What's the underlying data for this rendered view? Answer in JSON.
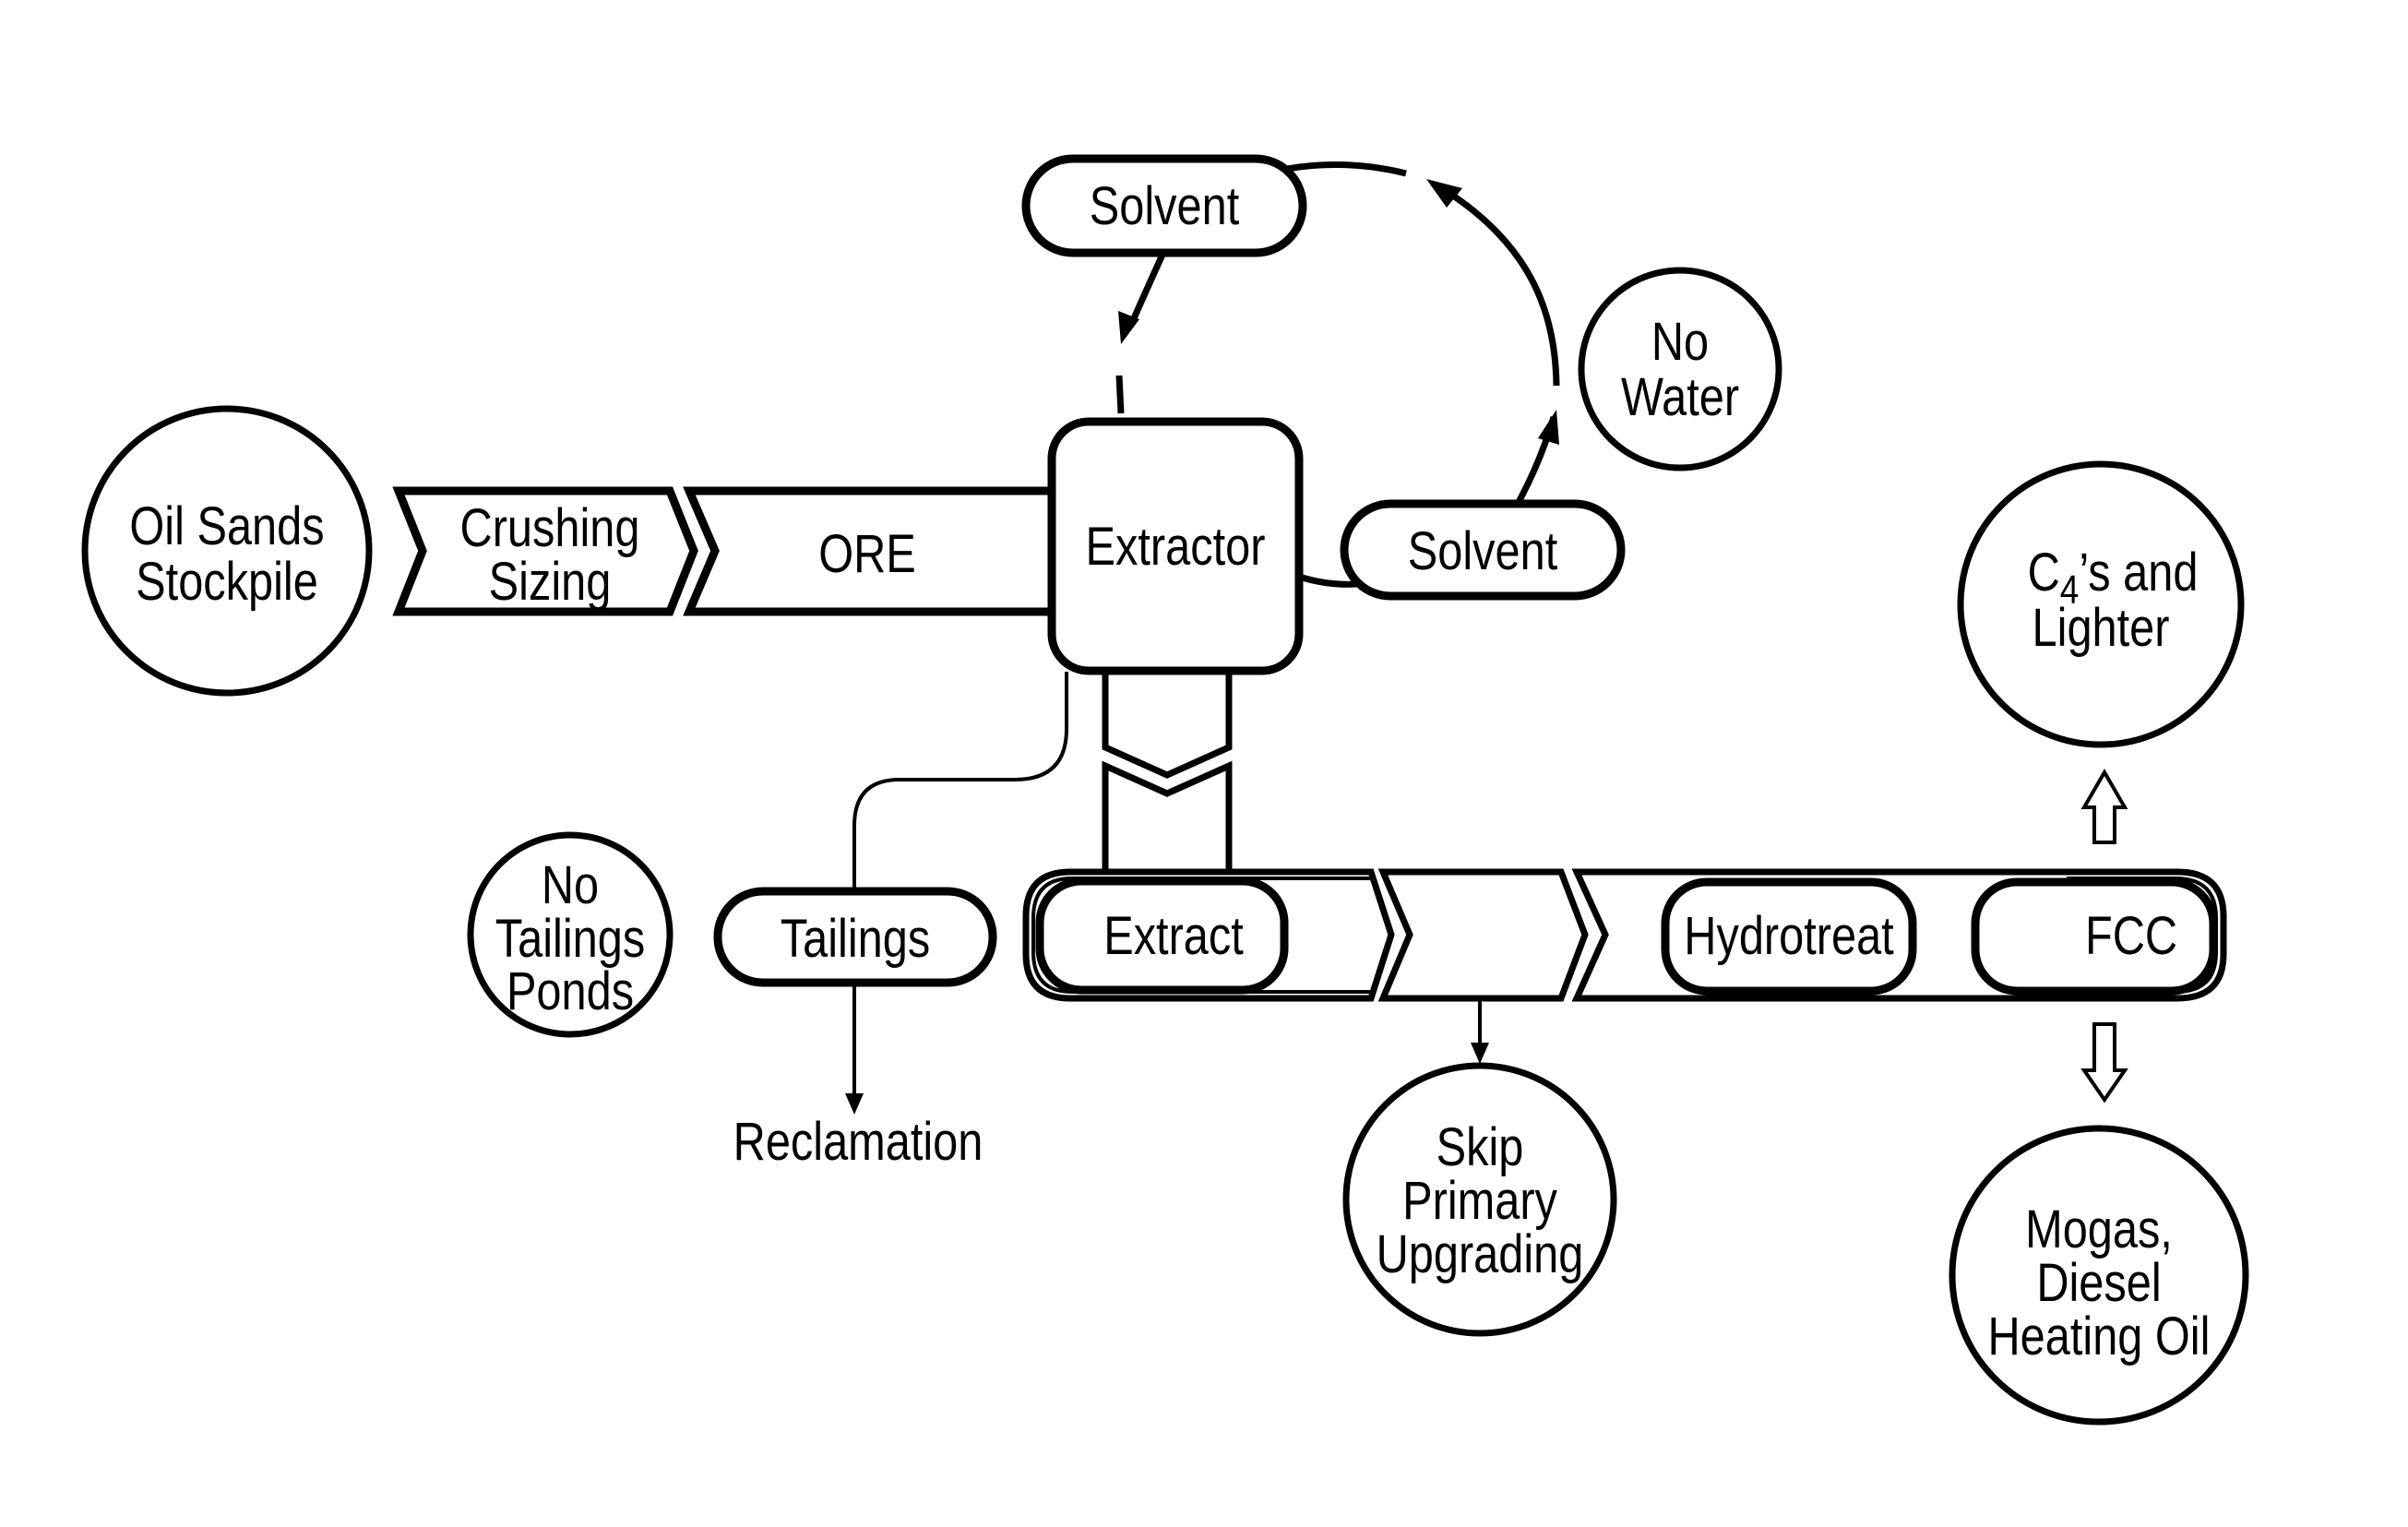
{
  "diagram": {
    "type": "process-flow",
    "colors": {
      "stroke": "#000000",
      "background": "#ffffff"
    },
    "nodes": {
      "oil_sands": {
        "shape": "circle",
        "lines": [
          "Oil Sands",
          "Stockpile"
        ]
      },
      "crushing": {
        "shape": "chevron",
        "lines": [
          "Crushing",
          "Sizing"
        ]
      },
      "ore": {
        "shape": "chevron",
        "label": "ORE"
      },
      "extractor": {
        "shape": "rounded-box",
        "label": "Extractor"
      },
      "solvent_top": {
        "shape": "pill",
        "label": "Solvent"
      },
      "solvent_right": {
        "shape": "pill",
        "label": "Solvent"
      },
      "no_water": {
        "shape": "circle",
        "lines": [
          "No",
          "Water"
        ]
      },
      "no_tailings": {
        "shape": "circle",
        "lines": [
          "No",
          "Tailings",
          "Ponds"
        ]
      },
      "tailings": {
        "shape": "pill",
        "label": "Tailings"
      },
      "reclamation": {
        "shape": "text",
        "label": "Reclamation"
      },
      "extract": {
        "shape": "pill",
        "label": "Extract"
      },
      "skip_segment": {
        "shape": "chevron",
        "label": ""
      },
      "hydrotreat": {
        "shape": "pill",
        "label": "Hydrotreat"
      },
      "fcc": {
        "shape": "pill",
        "label": "FCC"
      },
      "skip_primary": {
        "shape": "circle",
        "lines": [
          "Skip",
          "Primary",
          "Upgrading"
        ]
      },
      "c4_lighter": {
        "shape": "circle",
        "lines_main": [
          "C",
          "’s and",
          "Lighter"
        ],
        "subscript": "4"
      },
      "mogas": {
        "shape": "circle",
        "lines": [
          "Mogas,",
          "Diesel",
          "Heating Oil"
        ]
      }
    },
    "edges": [
      {
        "from": "oil_sands",
        "to": "crushing",
        "style": "adjacent"
      },
      {
        "from": "crushing",
        "to": "ore",
        "style": "chevron"
      },
      {
        "from": "ore",
        "to": "extractor",
        "style": "chevron"
      },
      {
        "from": "extractor",
        "to": "solvent_right",
        "style": "line"
      },
      {
        "from": "solvent_right",
        "to": "solvent_top",
        "style": "curved-arrow-dashed-loop"
      },
      {
        "from": "solvent_top",
        "to": "extractor",
        "style": "curved-arrow-dashed"
      },
      {
        "from": "extractor",
        "to": "tailings",
        "style": "thin-line"
      },
      {
        "from": "tailings",
        "to": "reclamation",
        "style": "arrow"
      },
      {
        "from": "extractor",
        "to": "extract",
        "style": "chevron-vertical"
      },
      {
        "from": "extract",
        "to": "skip_segment",
        "style": "chevron"
      },
      {
        "from": "skip_segment",
        "to": "hydrotreat",
        "style": "chevron"
      },
      {
        "from": "skip_segment",
        "to": "skip_primary",
        "style": "arrow"
      },
      {
        "from": "fcc",
        "to": "c4_lighter",
        "style": "hollow-arrow-up"
      },
      {
        "from": "fcc",
        "to": "mogas",
        "style": "hollow-arrow-down"
      }
    ]
  }
}
